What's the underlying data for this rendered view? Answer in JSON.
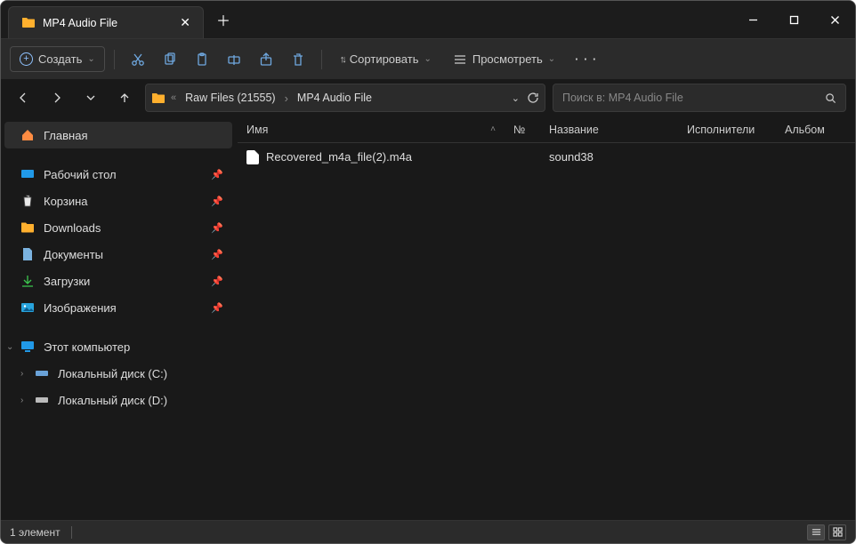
{
  "tab": {
    "title": "MP4 Audio File"
  },
  "toolbar": {
    "create": "Создать",
    "sort": "Сортировать",
    "view": "Просмотреть"
  },
  "breadcrumb": {
    "p1": "Raw Files (21555)",
    "p2": "MP4 Audio File"
  },
  "search": {
    "placeholder": "Поиск в: MP4 Audio File"
  },
  "sidebar": {
    "home": "Главная",
    "desktop": "Рабочий стол",
    "recycle": "Корзина",
    "downloads": "Downloads",
    "documents": "Документы",
    "downloads_ru": "Загрузки",
    "images": "Изображения",
    "thispc": "Этот компьютер",
    "diskC": "Локальный диск (C:)",
    "diskD": "Локальный диск (D:)"
  },
  "columns": {
    "name": "Имя",
    "num": "№",
    "title": "Название",
    "artist": "Исполнители",
    "album": "Альбом"
  },
  "files": [
    {
      "name": "Recovered_m4a_file(2).m4a",
      "num": "",
      "title": "sound38",
      "artist": "",
      "album": ""
    }
  ],
  "status": {
    "count": "1 элемент"
  }
}
